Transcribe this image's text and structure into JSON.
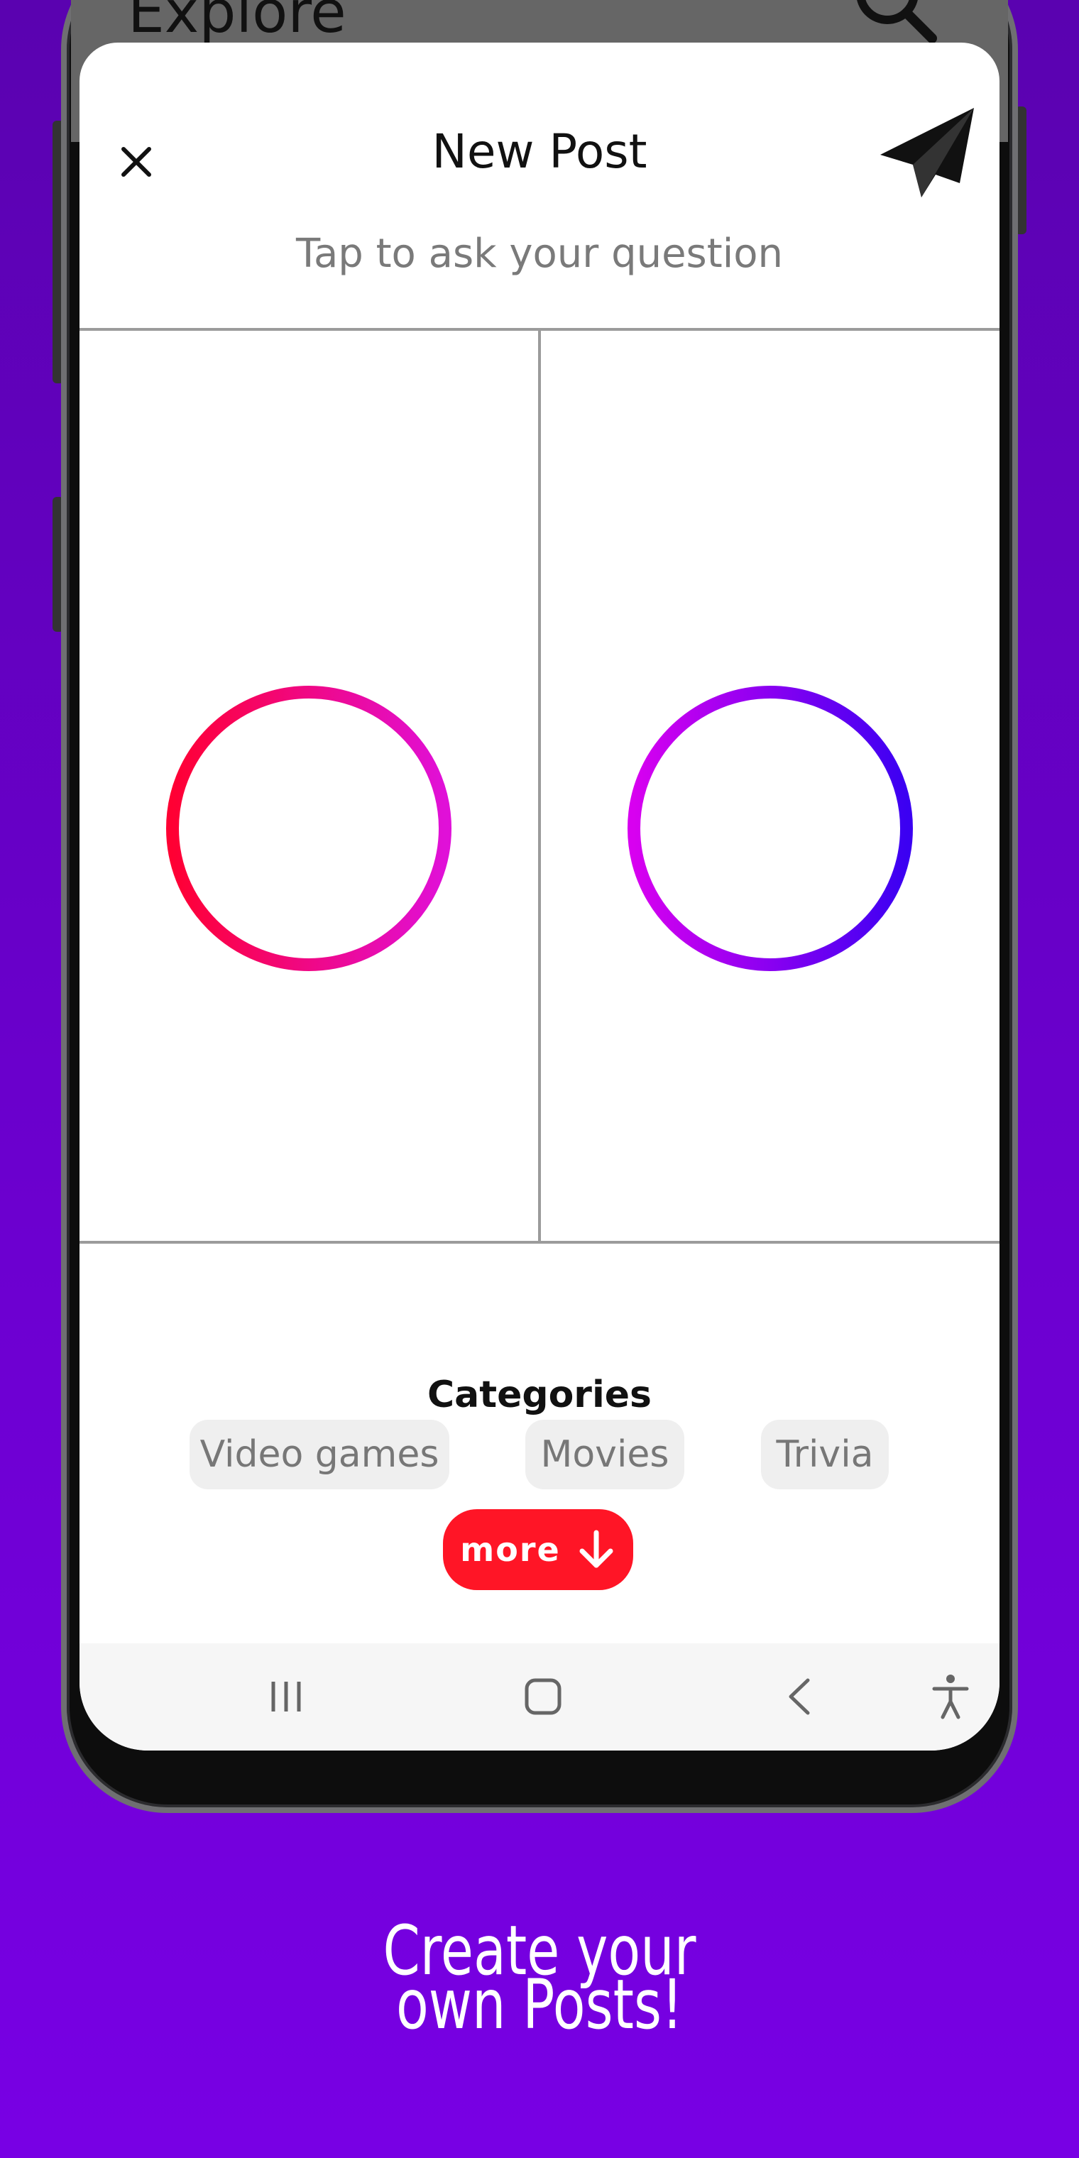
{
  "background_app": {
    "title": "Explore"
  },
  "header": {
    "title": "New Post",
    "close_icon": "close-icon",
    "send_icon": "paper-plane-icon"
  },
  "question": {
    "placeholder": "Tap to ask your question"
  },
  "image_slots": [
    {
      "icon": "add-circle-icon",
      "gradient": [
        "#ff0033",
        "#e010d8"
      ]
    },
    {
      "icon": "add-circle-icon",
      "gradient": [
        "#d800f0",
        "#3b00f2"
      ]
    }
  ],
  "categories": {
    "title": "Categories",
    "chips": [
      "Video games",
      "Movies",
      "Trivia"
    ],
    "more_label": "more"
  },
  "nav_bar": {
    "icons": [
      "recents-icon",
      "home-icon",
      "back-icon",
      "accessibility-icon"
    ]
  },
  "caption": {
    "line1": "Create your",
    "line2": "own Posts!"
  },
  "colors": {
    "accent": "#ff1526",
    "background_top": "#5a02b0",
    "background_bottom": "#7800e4"
  }
}
